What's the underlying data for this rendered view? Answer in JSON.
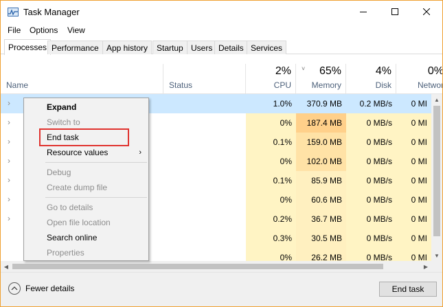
{
  "window": {
    "title": "Task Manager"
  },
  "icons": {
    "app": "task-manager-icon",
    "minimize": "minimize-icon",
    "maximize": "maximize-icon",
    "close": "close-icon",
    "expand_row": "chevron-right-icon",
    "submenu": "chevron-right-icon",
    "fewer": "chevron-up-icon",
    "sort": "sort-down-icon"
  },
  "menu": [
    "File",
    "Options",
    "View"
  ],
  "tabs": [
    "Processes",
    "Performance",
    "App history",
    "Startup",
    "Users",
    "Details",
    "Services"
  ],
  "active_tab": "Processes",
  "columns": {
    "name": {
      "label": "Name"
    },
    "status": {
      "label": "Status"
    },
    "cpu": {
      "percent": "2%",
      "label": "CPU"
    },
    "memory": {
      "percent": "65%",
      "label": "Memory",
      "sort": "˅"
    },
    "disk": {
      "percent": "4%",
      "label": "Disk"
    },
    "network": {
      "percent": "0%",
      "label": "Network"
    }
  },
  "rows": [
    {
      "cpu": "1.0%",
      "memory": "370.9 MB",
      "disk": "0.2 MB/s",
      "network": "0 MI"
    },
    {
      "cpu": "0%",
      "memory": "187.4 MB",
      "disk": "0 MB/s",
      "network": "0 MI"
    },
    {
      "cpu": "0.1%",
      "memory": "159.0 MB",
      "disk": "0 MB/s",
      "network": "0 MI"
    },
    {
      "cpu": "0%",
      "memory": "102.0 MB",
      "disk": "0 MB/s",
      "network": "0 MI"
    },
    {
      "cpu": "0.1%",
      "memory": "85.9 MB",
      "disk": "0 MB/s",
      "network": "0 MI"
    },
    {
      "cpu": "0%",
      "memory": "60.6 MB",
      "disk": "0 MB/s",
      "network": "0 MI"
    },
    {
      "cpu": "0.2%",
      "memory": "36.7 MB",
      "disk": "0 MB/s",
      "network": "0 MI"
    },
    {
      "cpu": "0.3%",
      "memory": "30.5 MB",
      "disk": "0 MB/s",
      "network": "0 MI"
    },
    {
      "cpu": "0%",
      "memory": "26.2 MB",
      "disk": "0 MB/s",
      "network": "0 MI"
    }
  ],
  "context_menu": {
    "expand": "Expand",
    "switch_to": "Switch to",
    "end_task": "End task",
    "resource_values": "Resource values",
    "debug": "Debug",
    "create_dump": "Create dump file",
    "go_to_details": "Go to details",
    "open_file_location": "Open file location",
    "search_online": "Search online",
    "properties": "Properties",
    "highlighted_item": "End task"
  },
  "footer": {
    "fewer_details": "Fewer details",
    "end_task_button": "End task"
  },
  "colors": {
    "selected_row": "#cce8ff",
    "cpu_heat": "#fff4c4",
    "memory_heat_high": "#ffd08a",
    "memory_heat_mid": "#ffe2a6",
    "memory_heat_low": "#fff0c0",
    "disk_heat": "#fff4c4",
    "highlight_border": "#e0322e",
    "window_border": "#f0a030"
  }
}
